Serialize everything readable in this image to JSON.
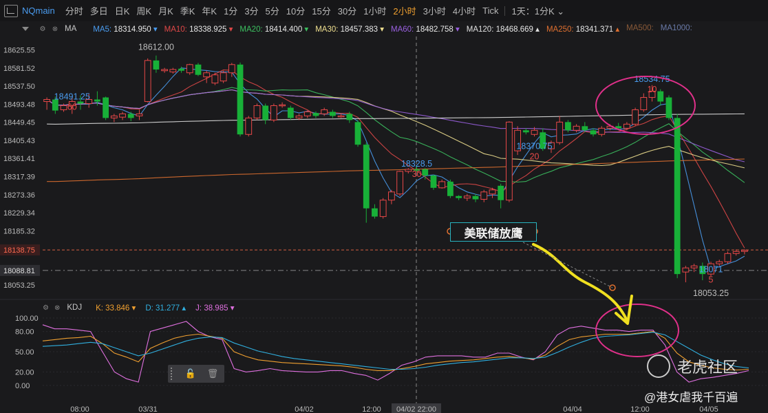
{
  "toolbar": {
    "symbol": "NQmain",
    "timeframes": [
      "分时",
      "多日",
      "日K",
      "周K",
      "月K",
      "季K",
      "年K",
      "1分",
      "3分",
      "5分",
      "10分",
      "15分",
      "30分",
      "1小时",
      "2小时",
      "3小时",
      "4小时",
      "Tick"
    ],
    "active": "2小时",
    "range": "1天：1分K",
    "range_caret": "⌄"
  },
  "ma_bar": {
    "name": "MA",
    "items": [
      {
        "label": "MA5:",
        "value": "18314.950",
        "arrow": "▾",
        "color": "#4a9cf0"
      },
      {
        "label": "MA10:",
        "value": "18338.925",
        "arrow": "▾",
        "color": "#e04848"
      },
      {
        "label": "MA20:",
        "value": "18414.400",
        "arrow": "▾",
        "color": "#3cc060"
      },
      {
        "label": "MA30:",
        "value": "18457.383",
        "arrow": "▾",
        "color": "#f0e090"
      },
      {
        "label": "MA60:",
        "value": "18482.758",
        "arrow": "▾",
        "color": "#9a60e0"
      },
      {
        "label": "MA120:",
        "value": "18468.669",
        "arrow": "▴",
        "color": "#e0e0e0"
      },
      {
        "label": "MA250:",
        "value": "18341.371",
        "arrow": "▴",
        "color": "#e07030"
      },
      {
        "label": "MA500:",
        "value": "",
        "arrow": "",
        "color": "#8a5a38"
      },
      {
        "label": "MA1000:",
        "value": "",
        "arrow": "",
        "color": "#6a7aa8"
      }
    ]
  },
  "kdj_bar": {
    "name": "KDJ",
    "items": [
      {
        "label": "K:",
        "value": "33.846",
        "arrow": "▾",
        "color": "#f0a030"
      },
      {
        "label": "D:",
        "value": "31.277",
        "arrow": "▴",
        "color": "#30b0e0"
      },
      {
        "label": "J:",
        "value": "38.985",
        "arrow": "▾",
        "color": "#e070e0"
      }
    ]
  },
  "chart_data": {
    "type": "candlestick",
    "price_axis": [
      "18625.55",
      "18581.52",
      "18537.50",
      "18493.48",
      "18449.45",
      "18405.43",
      "18361.41",
      "18317.39",
      "18273.36",
      "18229.34",
      "18185.32",
      "18138.75",
      "18088.81",
      "18053.25"
    ],
    "current_price": "18138.75",
    "ref_price": "18088.81",
    "ylim": [
      18030,
      18650
    ],
    "time_labels": [
      "08:00",
      "03/31",
      "04/02",
      "12:00",
      "04/02 22:00",
      "04/04",
      "12:00",
      "04/05"
    ],
    "candles": [
      [
        18500,
        18505,
        18480,
        18510
      ],
      [
        18505,
        18478,
        18470,
        18512
      ],
      [
        18480,
        18490,
        18475,
        18495
      ],
      [
        18490,
        18500,
        18470,
        18510
      ],
      [
        18500,
        18495,
        18480,
        18515
      ],
      [
        18495,
        18505,
        18485,
        18520
      ],
      [
        18505,
        18500,
        18490,
        18525
      ],
      [
        18510,
        18460,
        18455,
        18512
      ],
      [
        18460,
        18465,
        18450,
        18470
      ],
      [
        18462,
        18470,
        18455,
        18475
      ],
      [
        18470,
        18460,
        18452,
        18475
      ],
      [
        18465,
        18470,
        18455,
        18480
      ],
      [
        18500,
        18600,
        18498,
        18605
      ],
      [
        18600,
        18578,
        18570,
        18612
      ],
      [
        18575,
        18578,
        18570,
        18582
      ],
      [
        18572,
        18578,
        18568,
        18582
      ],
      [
        18580,
        18575,
        18570,
        18585
      ],
      [
        18570,
        18590,
        18565,
        18592
      ],
      [
        18590,
        18565,
        18562,
        18594
      ],
      [
        18560,
        18570,
        18545,
        18575
      ],
      [
        18545,
        18565,
        18540,
        18570
      ],
      [
        18550,
        18570,
        18545,
        18575
      ],
      [
        18570,
        18590,
        18560,
        18594
      ],
      [
        18590,
        18420,
        18415,
        18595
      ],
      [
        18420,
        18460,
        18415,
        18465
      ],
      [
        18460,
        18490,
        18455,
        18495
      ],
      [
        18490,
        18455,
        18445,
        18495
      ],
      [
        18455,
        18490,
        18450,
        18495
      ],
      [
        18490,
        18492,
        18485,
        18498
      ],
      [
        18485,
        18460,
        18455,
        18490
      ],
      [
        18460,
        18465,
        18455,
        18470
      ],
      [
        18465,
        18475,
        18460,
        18478
      ],
      [
        18472,
        18465,
        18460,
        18476
      ],
      [
        18470,
        18480,
        18465,
        18485
      ],
      [
        18475,
        18465,
        18460,
        18480
      ],
      [
        18465,
        18465,
        18460,
        18470
      ],
      [
        18470,
        18455,
        18448,
        18475
      ],
      [
        18450,
        18395,
        18390,
        18455
      ],
      [
        18395,
        18240,
        18205,
        18400
      ],
      [
        18240,
        18220,
        18215,
        18250
      ],
      [
        18220,
        18260,
        18215,
        18265
      ],
      [
        18260,
        18280,
        18250,
        18285
      ],
      [
        18275,
        18330,
        18270,
        18332
      ],
      [
        18330,
        18335,
        18325,
        18338
      ],
      [
        18335,
        18332,
        18328,
        18342
      ],
      [
        18335,
        18320,
        18310,
        18338
      ],
      [
        18320,
        18290,
        18285,
        18322
      ],
      [
        18290,
        18305,
        18288,
        18310
      ],
      [
        18305,
        18270,
        18265,
        18310
      ],
      [
        18270,
        18265,
        18260,
        18272
      ],
      [
        18265,
        18270,
        18258,
        18275
      ],
      [
        18270,
        18262,
        18255,
        18275
      ],
      [
        18262,
        18280,
        18255,
        18285
      ],
      [
        18275,
        18285,
        18265,
        18290
      ],
      [
        18295,
        18260,
        18240,
        18300
      ],
      [
        18260,
        18450,
        18255,
        18452
      ],
      [
        18380,
        18430,
        18370,
        18440
      ],
      [
        18430,
        18425,
        18420,
        18435
      ],
      [
        18420,
        18430,
        18415,
        18438
      ],
      [
        18425,
        18385,
        18380,
        18435
      ],
      [
        18385,
        18400,
        18375,
        18405
      ],
      [
        18400,
        18450,
        18395,
        18465
      ],
      [
        18450,
        18430,
        18425,
        18455
      ],
      [
        18430,
        18440,
        18425,
        18445
      ],
      [
        18440,
        18430,
        18425,
        18450
      ],
      [
        18430,
        18420,
        18415,
        18435
      ],
      [
        18420,
        18435,
        18415,
        18440
      ],
      [
        18435,
        18440,
        18430,
        18445
      ],
      [
        18440,
        18435,
        18430,
        18448
      ],
      [
        18435,
        18445,
        18430,
        18450
      ],
      [
        18445,
        18480,
        18440,
        18485
      ],
      [
        18480,
        18510,
        18475,
        18520
      ],
      [
        18510,
        18525,
        18500,
        18540
      ],
      [
        18525,
        18500,
        18490,
        18530
      ],
      [
        18510,
        18460,
        18455,
        18515
      ],
      [
        18460,
        18080,
        18070,
        18470
      ],
      [
        18085,
        18095,
        18060,
        18100
      ],
      [
        18095,
        18100,
        18085,
        18105
      ],
      [
        18100,
        18080,
        18065,
        18108
      ],
      [
        18080,
        18105,
        18075,
        18110
      ],
      [
        18105,
        18110,
        18100,
        18115
      ],
      [
        18110,
        18130,
        18105,
        18135
      ],
      [
        18130,
        18135,
        18125,
        18140
      ],
      [
        18135,
        18138,
        18128,
        18140
      ]
    ],
    "annotations": [
      {
        "text": "18491.25",
        "sub": "60"
      },
      {
        "text": "18612.00",
        "sub": ""
      },
      {
        "text": "18328.5",
        "sub": "30"
      },
      {
        "text": "18370.75",
        "sub": "20"
      },
      {
        "text": "18534.75",
        "sub": "10"
      },
      {
        "text": "18071",
        "sub": "5"
      },
      {
        "text": "18053.25",
        "sub": ""
      }
    ],
    "kdj_axis": [
      "100.00",
      "80.00",
      "50.00",
      "20.00",
      "0.00"
    ],
    "kdj": {
      "K": [
        66,
        68,
        70,
        71,
        73,
        62,
        48,
        42,
        35,
        55,
        63,
        70,
        74,
        76,
        73,
        70,
        50,
        43,
        38,
        36,
        34,
        33,
        32,
        31,
        30,
        29,
        27,
        24,
        22,
        22,
        25,
        28,
        32,
        34,
        36,
        37,
        38,
        40,
        42,
        43,
        41,
        39,
        45,
        58,
        68,
        72,
        74,
        76,
        76,
        76,
        78,
        80,
        70,
        48,
        35,
        30,
        26,
        24,
        23,
        24
      ],
      "D": [
        58,
        59,
        60,
        62,
        64,
        62,
        56,
        50,
        44,
        48,
        54,
        60,
        66,
        70,
        72,
        71,
        63,
        57,
        51,
        47,
        43,
        40,
        38,
        36,
        34,
        32,
        30,
        28,
        26,
        24,
        24,
        25,
        27,
        30,
        32,
        34,
        35,
        37,
        39,
        41,
        41,
        40,
        42,
        49,
        57,
        64,
        70,
        73,
        74,
        75,
        77,
        79,
        75,
        65,
        55,
        45,
        38,
        32,
        28,
        26
      ],
      "J": [
        90,
        84,
        84,
        82,
        80,
        50,
        20,
        10,
        5,
        80,
        85,
        90,
        95,
        80,
        72,
        68,
        25,
        20,
        22,
        25,
        22,
        21,
        20,
        20,
        22,
        22,
        18,
        15,
        8,
        18,
        30,
        35,
        42,
        44,
        44,
        44,
        42,
        42,
        48,
        48,
        42,
        38,
        50,
        75,
        85,
        88,
        85,
        82,
        82,
        80,
        82,
        82,
        60,
        20,
        5,
        10,
        12,
        15,
        18,
        22
      ]
    },
    "annotation_box": "美联储放鹰"
  },
  "float_toolbar": {
    "lock": "🔓",
    "trash": "🗑"
  },
  "watermark": {
    "brand": "老虎社区",
    "user": "@港女虐我千百遍"
  }
}
